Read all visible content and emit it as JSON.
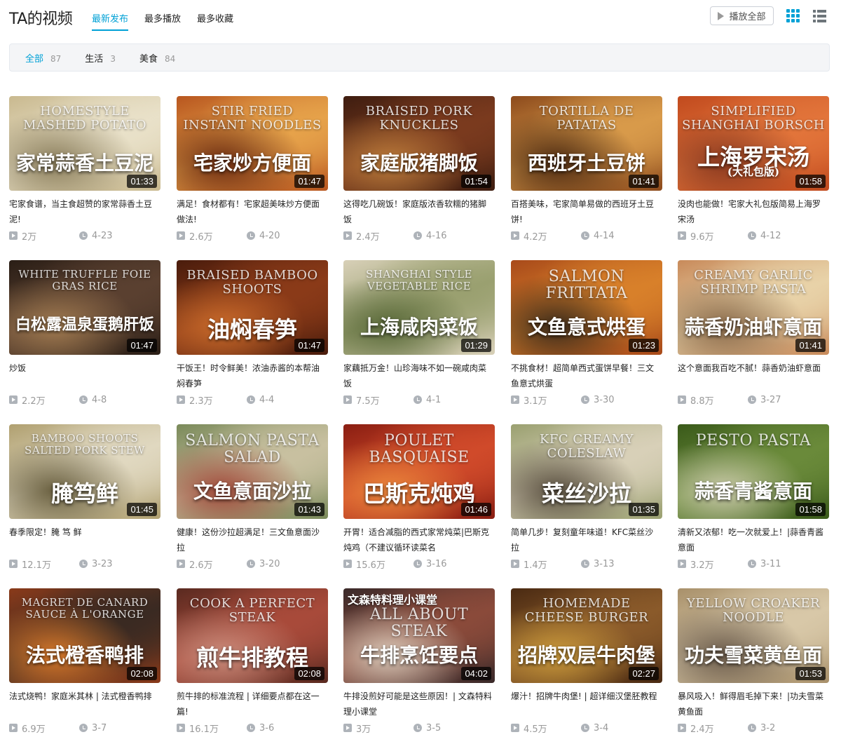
{
  "header": {
    "title": "TA的视频",
    "tabs": [
      {
        "label": "最新发布",
        "active": true
      },
      {
        "label": "最多播放",
        "active": false
      },
      {
        "label": "最多收藏",
        "active": false
      }
    ],
    "play_all_label": "播放全部",
    "icons": {
      "play": "play-icon",
      "grid_view": "grid-view-icon",
      "list_view": "list-view-icon"
    }
  },
  "filter": {
    "chips": [
      {
        "label": "全部",
        "count": "87",
        "active": true
      },
      {
        "label": "生活",
        "count": "3",
        "active": false
      },
      {
        "label": "美食",
        "count": "84",
        "active": false
      }
    ]
  },
  "accent_color": "#00a1d6",
  "videos": [
    {
      "en": "Homestyle Mashed Potato",
      "cn": "家常蒜香土豆泥",
      "duration": "01:33",
      "title": "宅家食谱，当主食超赞的家常蒜香土豆泥!",
      "views": "2万",
      "date": "4-23",
      "colors": [
        "#e9e1c9",
        "#c9b98f",
        "#8a7d5a"
      ]
    },
    {
      "en": "Stir Fried Instant Noodles",
      "cn": "宅家炒方便面",
      "duration": "01:47",
      "title": "满足！食材都有！宅家超美味炒方便面做法!",
      "views": "2.6万",
      "date": "4-20",
      "colors": [
        "#e6a24a",
        "#b8561f",
        "#6b2a10"
      ]
    },
    {
      "en": "Braised Pork Knuckles",
      "cn": "家庭版猪脚饭",
      "duration": "01:54",
      "title": "这得吃几碗饭！家庭版浓香软糯的猪脚饭",
      "views": "2.4万",
      "date": "4-16",
      "colors": [
        "#7a3a1e",
        "#3e1d10",
        "#b97a3a"
      ]
    },
    {
      "en": "Tortilla de Patatas",
      "cn": "西班牙土豆饼",
      "duration": "01:41",
      "title": "百搭美味，宅家简单易做的西班牙土豆饼!",
      "views": "4.2万",
      "date": "4-14",
      "colors": [
        "#d89a4a",
        "#8c4a1c",
        "#4a2810"
      ]
    },
    {
      "en": "Simplified Shanghai Borsch",
      "cn": "上海罗宋汤",
      "sub": "(大礼包版)",
      "duration": "01:58",
      "title": "没肉也能做！宅家大礼包版简易上海罗宋汤",
      "views": "9.6万",
      "date": "4-12",
      "colors": [
        "#e2743a",
        "#c14a1e",
        "#8a3a20"
      ]
    },
    {
      "en": "White Truffle Foie Gras Rice",
      "cn": "白松露温泉蛋鹅肝饭",
      "duration": "01:47",
      "title": "炒饭",
      "views": "2.2万",
      "date": "4-8",
      "colors": [
        "#5a4030",
        "#2a1e16",
        "#a07a50"
      ]
    },
    {
      "en": "Braised Bamboo Shoots",
      "cn": "油焖春笋",
      "duration": "01:47",
      "title": "干饭王！时令鲜美！浓油赤酱的本帮油焖春笋",
      "views": "2.3万",
      "date": "4-4",
      "colors": [
        "#8a3a18",
        "#4a1c0c",
        "#c86a2a"
      ]
    },
    {
      "en": "Shanghai Style Vegetable Rice",
      "cn": "上海咸肉菜饭",
      "duration": "01:29",
      "title": "家藕抵万金！山珍海味不如一碗咸肉菜饭",
      "views": "7.5万",
      "date": "4-1",
      "colors": [
        "#9aa070",
        "#d8d0b8",
        "#5a6a3a"
      ]
    },
    {
      "en": "Salmon Frittata",
      "cn": "文鱼意式烘蛋",
      "duration": "01:23",
      "title": "不挑食材！超简单西式蛋饼早餐！三文鱼意式烘蛋",
      "views": "3.1万",
      "date": "3-30",
      "colors": [
        "#d8802a",
        "#a84a1a",
        "#3a2a1a"
      ]
    },
    {
      "en": "Creamy Garlic Shrimp Pasta",
      "cn": "蒜香奶油虾意面",
      "duration": "01:41",
      "title": "这个意面我百吃不腻！蒜香奶油虾意面",
      "views": "8.8万",
      "date": "3-27",
      "colors": [
        "#e8d2a8",
        "#c88a5a",
        "#8a6a4a"
      ]
    },
    {
      "en": "Bamboo Shoots Salted Pork Stew",
      "cn": "腌笃鲜",
      "duration": "01:45",
      "title": "春季限定！腌 笃 鲜",
      "views": "12.1万",
      "date": "3-23",
      "colors": [
        "#e0d8c0",
        "#b0a070",
        "#6a6040"
      ]
    },
    {
      "en": "Salmon Pasta Salad",
      "cn": "文鱼意面沙拉",
      "duration": "01:43",
      "title": "健康！这份沙拉超满足！三文鱼意面沙拉",
      "views": "2.6万",
      "date": "3-20",
      "colors": [
        "#c8c0a0",
        "#7a8a5a",
        "#a04a3a"
      ]
    },
    {
      "en": "Poulet Basquaise",
      "cn": "巴斯克炖鸡",
      "duration": "01:46",
      "title": "开胃！适合减脂的西式家常炖菜|巴斯克炖鸡（不建议循环读菜名",
      "views": "15.6万",
      "date": "3-16",
      "colors": [
        "#d04a2a",
        "#8a1e12",
        "#e8843a"
      ]
    },
    {
      "en": "KFC Creamy Coleslaw",
      "cn": "菜丝沙拉",
      "duration": "01:35",
      "title": "简单几步！复刻童年味道！KFC菜丝沙拉",
      "views": "1.4万",
      "date": "3-13",
      "colors": [
        "#d8d0b8",
        "#9aa070",
        "#5a5040"
      ]
    },
    {
      "en": "Pesto Pasta",
      "cn": "蒜香青酱意面",
      "duration": "01:58",
      "title": "清新又浓郁！吃一次就爱上！|蒜香青酱意面",
      "views": "3.2万",
      "date": "3-11",
      "colors": [
        "#6a8a3a",
        "#3a5a1a",
        "#c8c8a8"
      ]
    },
    {
      "en": "Magret de Canard Sauce à l'Orange",
      "cn": "法式橙香鸭排",
      "duration": "02:08",
      "title": "法式烧鸭！家庭米其林 | 法式橙香鸭排",
      "views": "6.9万",
      "date": "3-7",
      "colors": [
        "#3a2a22",
        "#8a3a1a",
        "#d8782a"
      ]
    },
    {
      "en": "Cook a Perfect Steak",
      "cn": "煎牛排教程",
      "duration": "02:08",
      "title": "煎牛排的标准流程 | 详细要点都在这一篇!",
      "views": "16.1万",
      "date": "3-6",
      "colors": [
        "#a84a3a",
        "#5a2a20",
        "#c88a7a"
      ]
    },
    {
      "en": "All About Steak",
      "cn": "牛排烹饪要点",
      "badge": "文森特料理小课堂",
      "duration": "04:02",
      "title": "牛排没煎好可能是这些原因！| 文森特料理小课堂",
      "views": "3万",
      "date": "3-5",
      "colors": [
        "#8a4a3a",
        "#3a2a2a",
        "#d8c8b8"
      ]
    },
    {
      "en": "Homemade Cheese Burger",
      "cn": "招牌双层牛肉堡",
      "duration": "02:27",
      "title": "爆汁！招牌牛肉堡! | 超详细汉堡胚教程",
      "views": "4.5万",
      "date": "3-4",
      "colors": [
        "#8a5a2a",
        "#4a2a12",
        "#c8983a"
      ]
    },
    {
      "en": "Yellow Croaker Noodle",
      "cn": "功夫雪菜黄鱼面",
      "duration": "01:53",
      "title": "暴风吸入！鲜得眉毛掉下来！|功夫雪菜黄鱼面",
      "views": "2.4万",
      "date": "3-2",
      "colors": [
        "#d8c8a8",
        "#a8906a",
        "#6a5a4a"
      ]
    }
  ]
}
